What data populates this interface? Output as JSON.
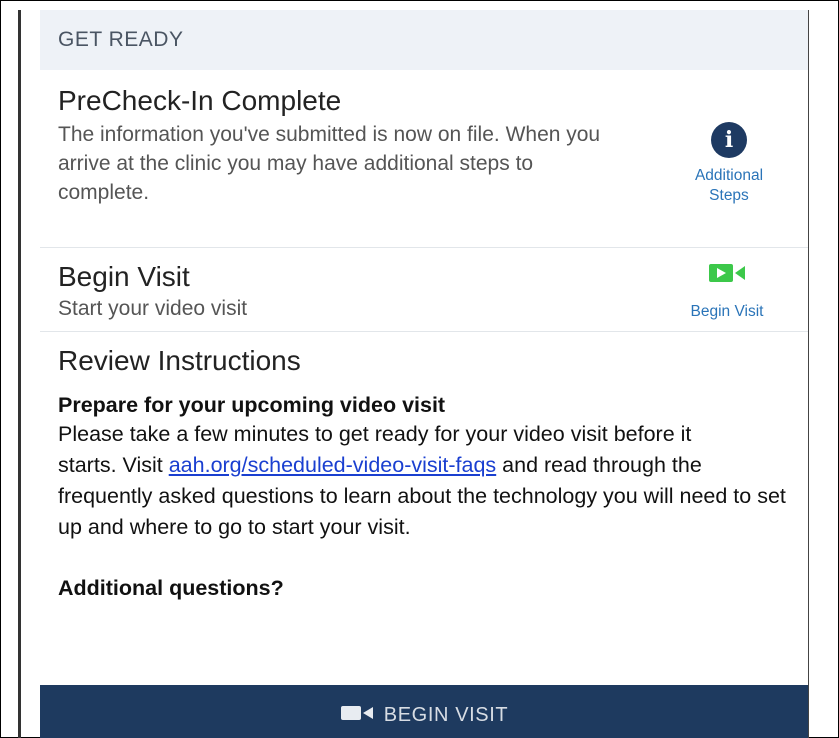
{
  "section": {
    "title": "GET READY"
  },
  "precheck": {
    "title": "PreCheck-In Complete",
    "description": "The information you've submitted is now on file. When you arrive at the clinic you may have additional steps to complete.",
    "action_icon_glyph": "i",
    "action_line1": "Additional",
    "action_line2": "Steps"
  },
  "begin": {
    "title": "Begin Visit",
    "description": "Start your video visit",
    "action_label": "Begin Visit"
  },
  "review": {
    "title": "Review Instructions",
    "heading": "Prepare for your upcoming video visit",
    "para_part1": "Please take a few minutes to get ready for your video visit before it",
    "para_part2": "starts. Visit ",
    "link_text": "aah.org/scheduled-video-visit-faqs",
    "para_part3": " and read through the frequently asked questions to learn about the technology you will need to set up and where to go to start your visit.",
    "additional": "Additional questions?"
  },
  "button": {
    "label": "BEGIN VISIT"
  },
  "colors": {
    "header_bg": "#eef2f7",
    "accent_blue": "#2a74b8",
    "info_icon": "#1e3a62",
    "video_green": "#3cc84a",
    "button_bg": "#1e3a5f",
    "link": "#1a3fd0"
  },
  "icons": {
    "info": "info-icon",
    "video_green": "video-camera-icon",
    "video_button": "video-camera-icon"
  }
}
